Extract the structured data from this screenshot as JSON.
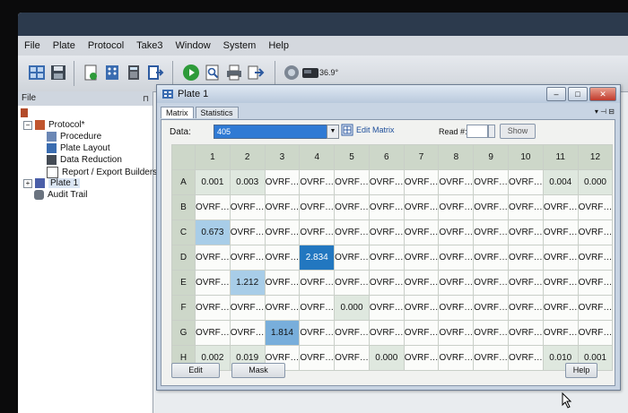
{
  "menu": [
    "File",
    "Plate",
    "Protocol",
    "Take3",
    "Window",
    "System",
    "Help"
  ],
  "toolbar": {
    "icons": [
      "layout-icon",
      "save-icon",
      "new-doc-icon",
      "plate-map-icon",
      "calculator-icon",
      "export-icon",
      "run-icon",
      "search-icon",
      "print-icon",
      "export-arrow-icon",
      "instrument-icon",
      "reader-icon"
    ],
    "angle": "36.9°"
  },
  "left_panel": {
    "header": "File",
    "tree": [
      {
        "label": "Protocol*",
        "level": 0,
        "icon": "protocol-icon",
        "expander": "−"
      },
      {
        "label": "Procedure",
        "level": 1,
        "icon": "procedure-icon"
      },
      {
        "label": "Plate Layout",
        "level": 1,
        "icon": "layout-icon"
      },
      {
        "label": "Data Reduction",
        "level": 1,
        "icon": "data-reduction-icon"
      },
      {
        "label": "Report / Export Builders",
        "level": 1,
        "icon": "report-icon"
      },
      {
        "label": "Plate 1",
        "level": 0,
        "icon": "plate-icon",
        "expander": "+",
        "selected": true
      },
      {
        "label": "Audit Trail",
        "level": 0,
        "icon": "audit-icon"
      }
    ]
  },
  "plate_window": {
    "title": "Plate 1",
    "tabs": [
      "Matrix",
      "Statistics"
    ],
    "data_label": "Data:",
    "data_value": "405",
    "edit_matrix": "Edit Matrix",
    "read_label": "Read #:",
    "show_label": "Show",
    "columns": [
      "1",
      "2",
      "3",
      "4",
      "5",
      "6",
      "7",
      "8",
      "9",
      "10",
      "11",
      "12"
    ],
    "rows": [
      {
        "label": "A",
        "cells": [
          "0.001",
          "0.003",
          "OVRF…",
          "OVRF…",
          "OVRF…",
          "OVRF…",
          "OVRF…",
          "OVRF…",
          "OVRF…",
          "OVRF…",
          "0.004",
          "0.000"
        ]
      },
      {
        "label": "B",
        "cells": [
          "OVRF…",
          "OVRF…",
          "OVRF…",
          "OVRF…",
          "OVRF…",
          "OVRF…",
          "OVRF…",
          "OVRF…",
          "OVRF…",
          "OVRF…",
          "OVRF…",
          "OVRF…"
        ]
      },
      {
        "label": "C",
        "cells": [
          "0.673",
          "OVRF…",
          "OVRF…",
          "OVRF…",
          "OVRF…",
          "OVRF…",
          "OVRF…",
          "OVRF…",
          "OVRF…",
          "OVRF…",
          "OVRF…",
          "OVRF…"
        ]
      },
      {
        "label": "D",
        "cells": [
          "OVRF…",
          "OVRF…",
          "OVRF…",
          "2.834",
          "OVRF…",
          "OVRF…",
          "OVRF…",
          "OVRF…",
          "OVRF…",
          "OVRF…",
          "OVRF…",
          "OVRF…"
        ]
      },
      {
        "label": "E",
        "cells": [
          "OVRF…",
          "1.212",
          "OVRF…",
          "OVRF…",
          "OVRF…",
          "OVRF…",
          "OVRF…",
          "OVRF…",
          "OVRF…",
          "OVRF…",
          "OVRF…",
          "OVRF…"
        ]
      },
      {
        "label": "F",
        "cells": [
          "OVRF…",
          "OVRF…",
          "OVRF…",
          "OVRF…",
          "0.000",
          "OVRF…",
          "OVRF…",
          "OVRF…",
          "OVRF…",
          "OVRF…",
          "OVRF…",
          "OVRF…"
        ]
      },
      {
        "label": "G",
        "cells": [
          "OVRF…",
          "OVRF…",
          "1.814",
          "OVRF…",
          "OVRF…",
          "OVRF…",
          "OVRF…",
          "OVRF…",
          "OVRF…",
          "OVRF…",
          "OVRF…",
          "OVRF…"
        ]
      },
      {
        "label": "H",
        "cells": [
          "0.002",
          "0.019",
          "OVRF…",
          "OVRF…",
          "OVRF…",
          "0.000",
          "OVRF…",
          "OVRF…",
          "OVRF…",
          "OVRF…",
          "0.010",
          "0.001"
        ]
      }
    ],
    "buttons": {
      "edit": "Edit",
      "mask": "Mask",
      "help": "Help"
    }
  },
  "colors": {
    "selection": "#2f7ad4",
    "highlight_strong": "#2277c0",
    "highlight_mid": "#78aedb",
    "highlight_light": "#a8cde8"
  }
}
